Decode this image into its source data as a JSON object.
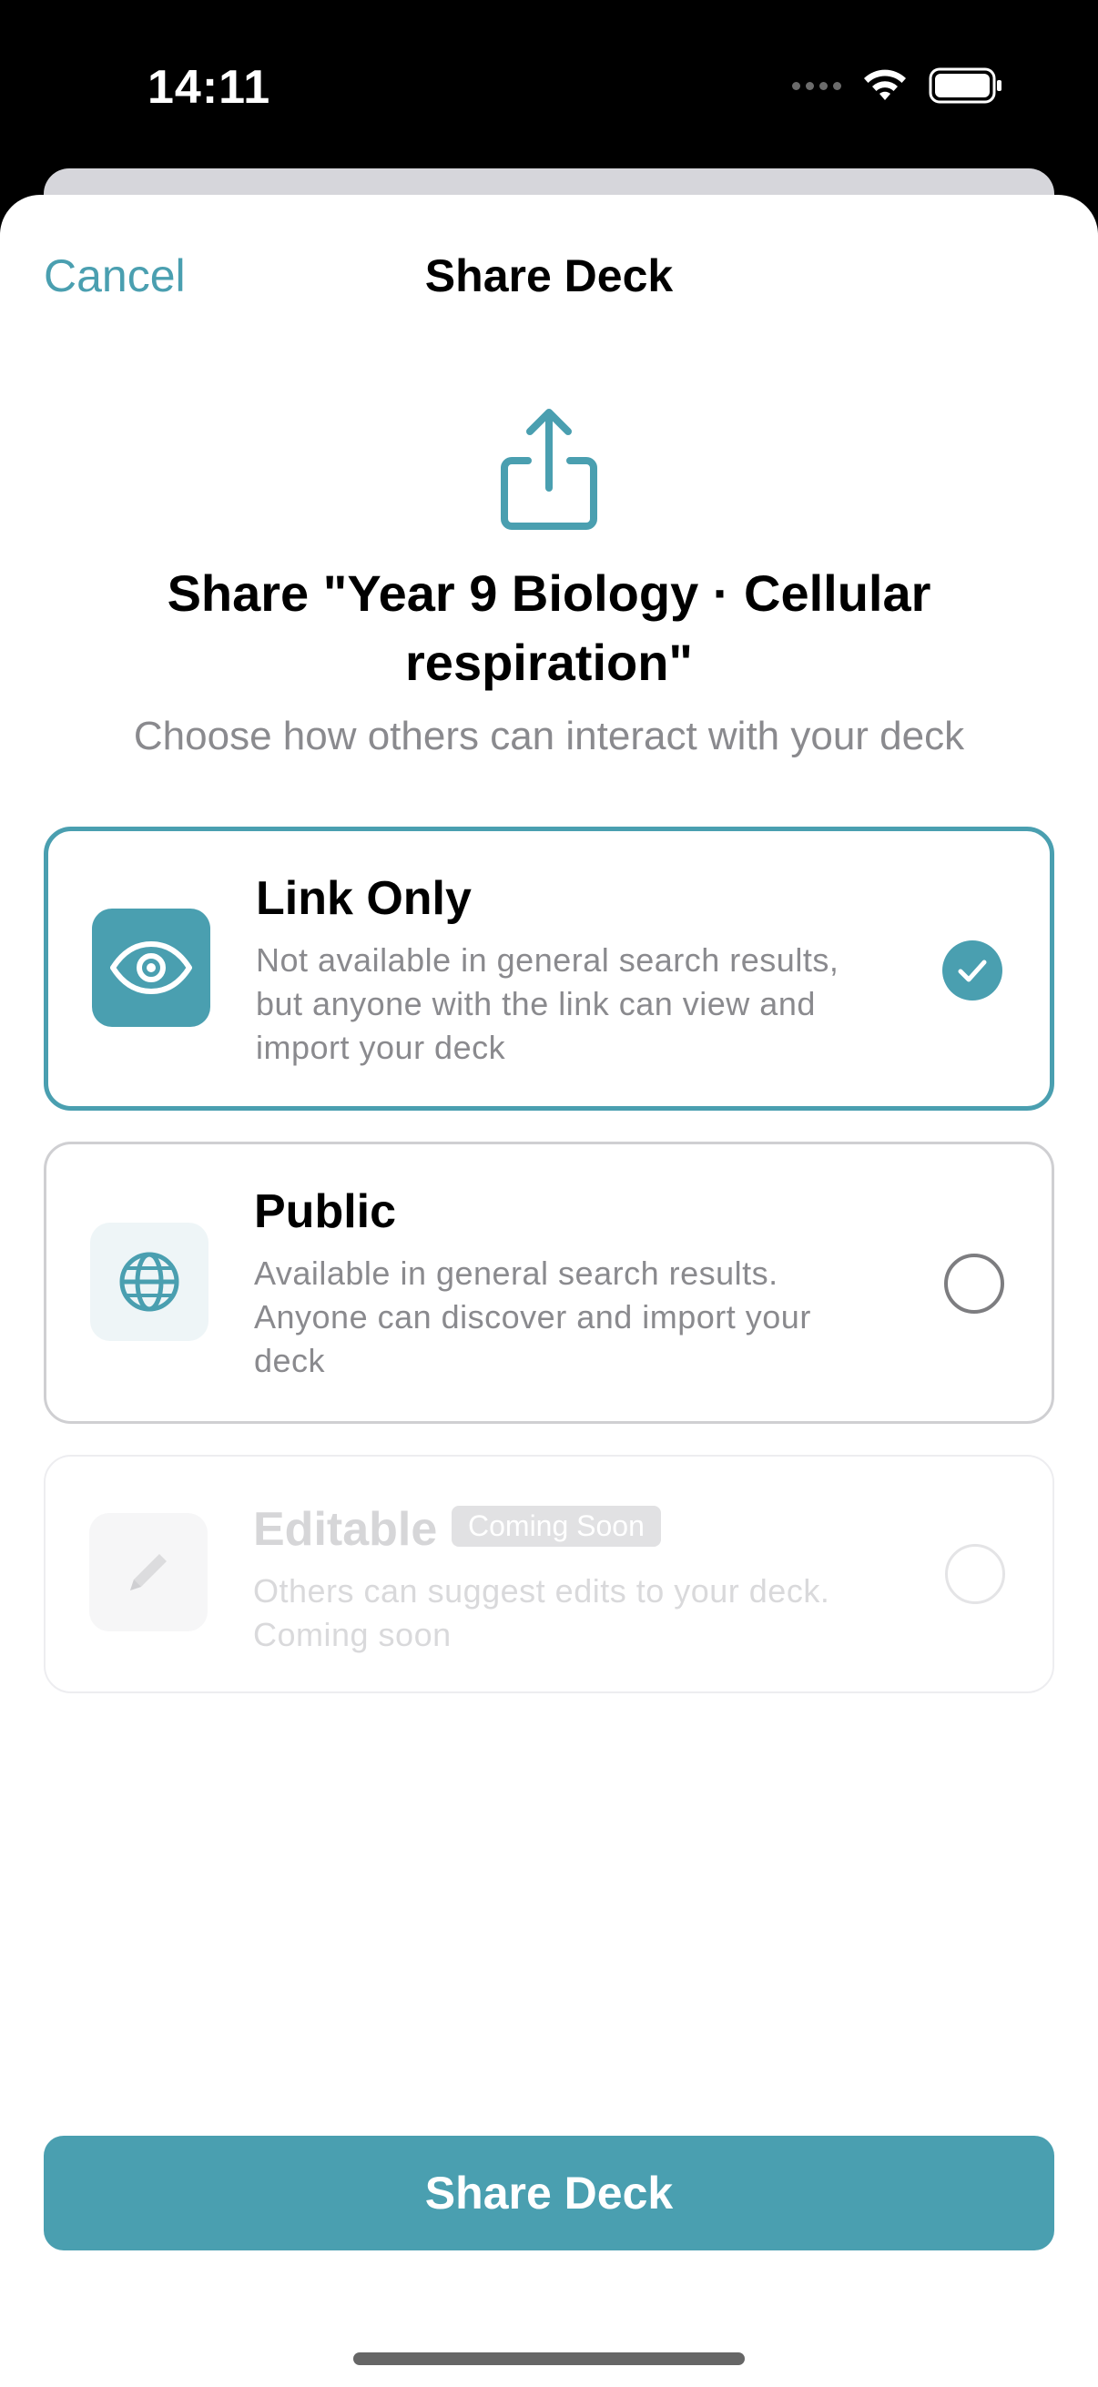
{
  "status_bar": {
    "time": "14:11"
  },
  "nav": {
    "cancel_label": "Cancel",
    "title": "Share Deck"
  },
  "header": {
    "headline": "Share \"Year 9 Biology · Cellular respiration\"",
    "subtitle": "Choose how others can interact with your deck"
  },
  "options": [
    {
      "title": "Link Only",
      "description": "Not available in general search results, but anyone with the link can view and import your deck",
      "icon": "eye-icon",
      "selected": true
    },
    {
      "title": "Public",
      "description": "Available in general search results. Anyone can discover and import your deck",
      "icon": "globe-icon",
      "selected": false
    },
    {
      "title": "Editable",
      "badge": "Coming Soon",
      "description": "Others can suggest edits to your deck. Coming soon",
      "icon": "pencil-icon",
      "selected": false,
      "disabled": true
    }
  ],
  "primary_button": {
    "label": "Share Deck"
  },
  "colors": {
    "accent": "#4a9fb0",
    "secondary_text": "#8a8a8e",
    "border": "#cfcfd2"
  }
}
